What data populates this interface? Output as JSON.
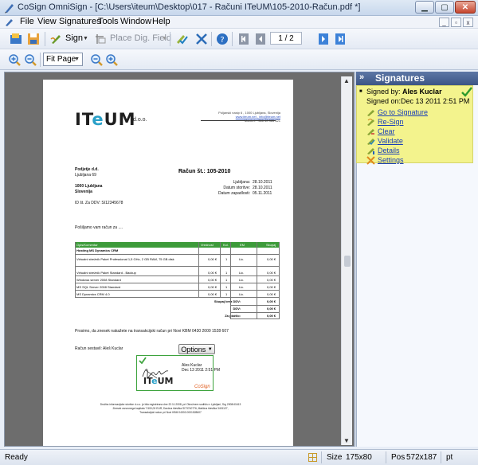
{
  "window": {
    "title": "CoSign OmniSign - [C:\\Users\\iteum\\Desktop\\017 - Računi ITeUM\\105-2010-Račun.pdf *]"
  },
  "menu": [
    "File",
    "View",
    "Signatures",
    "Tools",
    "Window",
    "Help"
  ],
  "toolbar": {
    "sign_label": "Sign",
    "place_field_label": "Place Dig. Field",
    "page_current": "1",
    "page_sep": "/",
    "page_total": "2",
    "zoom_mode": "Fit Page"
  },
  "document": {
    "logo_text_1": "IT",
    "logo_text_2": "e",
    "logo_text_3": "UM",
    "logo_suffix": "d.o.o.",
    "header_address_1": "Poljanski nasip 6 , 1000 Ljubljana, Slovenija",
    "header_address_2": "www.iteum.net , info@iteum.net",
    "header_address_3": "Mobitel: +386 40 385 621",
    "recipient": {
      "name": "Podjetje d.d.",
      "street": "Ljubljana 69",
      "city": "1000 Ljubljana",
      "country": "Slovenija",
      "vat": "ID št. Za DDV: SI12345678"
    },
    "invoice_title": "Račun št.: 105-2010",
    "place_label": "Ljubljana:",
    "place_value": "28.10.2011",
    "service_date_label": "Datum storitve:",
    "service_date_value": "28.10.2011",
    "due_date_label": "Datum zapadlosti:",
    "due_date_value": "05.11.2011",
    "intro": "Pošiljamo vam račun za ....",
    "table": {
      "headers": [
        "Opis/Komentar",
        "Vrednost",
        "Kol.",
        "EM",
        "Skupaj"
      ],
      "section": "Hosting MS Dynamics CRM",
      "rows": [
        {
          "desc": "Virtualni strežnik Paket Professional 1,5 GHz, 2 GB RAM, 75 GB disk",
          "value": "0,00 €",
          "qty": "1",
          "unit": "Lic.",
          "total": "0,00 €"
        },
        {
          "desc": "Virtualni strežnik Paket Standard - Backup",
          "value": "0,00 €",
          "qty": "1",
          "unit": "Lic.",
          "total": "0,00 €"
        },
        {
          "desc": "Windows server 2008 Standard",
          "value": "0,00 €",
          "qty": "1",
          "unit": "Lic.",
          "total": "0,00 €"
        },
        {
          "desc": "MS SQL Server 2008 Standard",
          "value": "0,00 €",
          "qty": "1",
          "unit": "Lic.",
          "total": "0,00 €"
        },
        {
          "desc": "MS Dynamics CRM 4.0",
          "value": "0,00 €",
          "qty": "1",
          "unit": "Lic.",
          "total": "0,00 €"
        }
      ],
      "sum_no_vat_label": "Skupaj brez DDV:",
      "sum_no_vat": "0,00 €",
      "vat_label": "DDV:",
      "vat": "0,00 €",
      "to_pay_label": "Za plačilo:",
      "to_pay": "0,00 €"
    },
    "payment_note": "Prosimo, da znesek nakažete na transakcijski račun pri Novi KBM 0430 2000 1528 607",
    "composed_by": "Račun sestavil:  Aleš Kuclar",
    "options_label": "Options",
    "sig_name": "Ales Kuclar",
    "sig_date": "Dec 13 2011 2:51 PM",
    "sig_logo_1": "IT",
    "sig_logo_2": "e",
    "sig_logo_3": "UM",
    "sig_cosign": "CoSign",
    "footer_1": "Družba informacijske storitve d.o.o. je bila registrirana dne 22.11.2008, pri Okrožnem sodišču v Ljubljani, Srg 2008/41613",
    "footer_2": "Znesek osnovnega kapitala 7.500,00 EUR, Davčna številka SI73740776, Matična številka 3401127,",
    "footer_3": "Transakcijski račun pri Novi KBM 04302-0001528607"
  },
  "signatures_panel": {
    "title": "Signatures",
    "signed_by_label": "Signed by:",
    "signed_by_name": "Ales Kuclar",
    "signed_on": "Signed on:Dec 13 2011 2:51 PM",
    "actions": [
      "Go to Signature",
      "Re-Sign",
      "Clear",
      "Validate",
      "Details",
      "Settings"
    ]
  },
  "status": {
    "ready": "Ready",
    "size_label": "Size",
    "size_value": "175x80",
    "pos_label": "Pos",
    "pos_value": "572x187",
    "unit": "pt"
  }
}
